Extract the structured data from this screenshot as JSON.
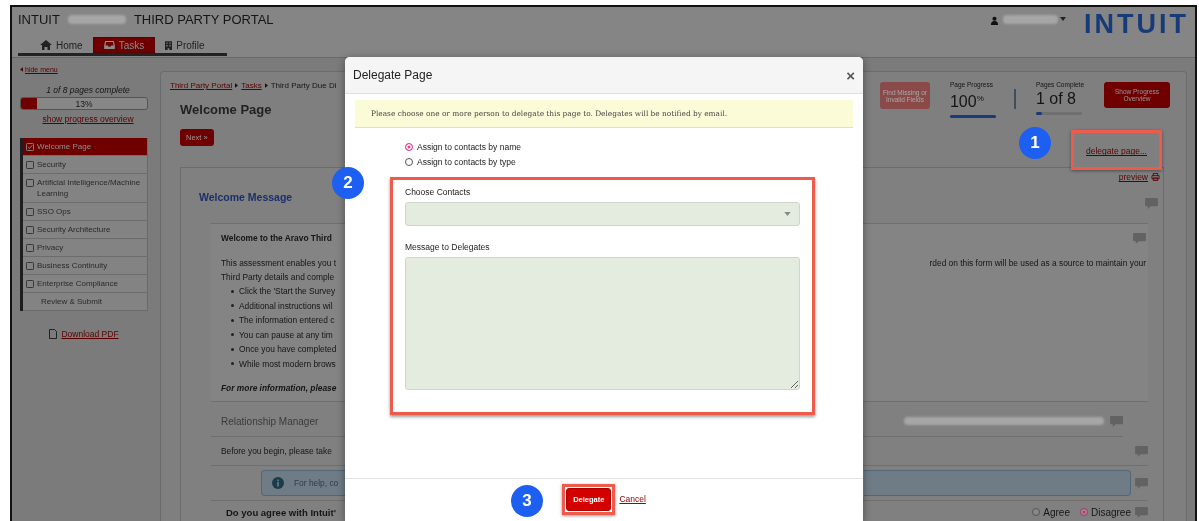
{
  "header": {
    "brand": "INTUIT",
    "title": "THIRD PARTY PORTAL",
    "logo": "INTUIT"
  },
  "nav_tabs": [
    {
      "label": "Home",
      "kind": "home",
      "selected": false
    },
    {
      "label": "Tasks",
      "kind": "tasks",
      "selected": true
    },
    {
      "label": "Profile",
      "kind": "profile",
      "selected": false
    }
  ],
  "sidebar": {
    "hide_menu": "hide menu",
    "progress_text": "1 of 8 pages complete",
    "progress": {
      "level": 0.13,
      "reading": "13%"
    },
    "overview_link": "show progress overview",
    "items": [
      {
        "label": "Welcome Page",
        "kind": "page",
        "checked": true,
        "selected": true
      },
      {
        "label": "Security",
        "kind": "page",
        "checked": false,
        "selected": false
      },
      {
        "label": "Artificial Intelligence/Machine Learning",
        "kind": "page",
        "checked": false,
        "selected": false
      },
      {
        "label": "SSO Ops",
        "kind": "page",
        "checked": false,
        "selected": false
      },
      {
        "label": "Security Architecture",
        "kind": "page",
        "checked": false,
        "selected": false
      },
      {
        "label": "Privacy",
        "kind": "page",
        "checked": false,
        "selected": false
      },
      {
        "label": "Business Continuity",
        "kind": "page",
        "checked": false,
        "selected": false
      },
      {
        "label": "Enterprise Compliance",
        "kind": "page",
        "checked": false,
        "selected": false
      },
      {
        "label": "Review & Submit",
        "kind": "submit",
        "selected": false
      }
    ],
    "download": "Download PDF"
  },
  "breadcrumb": [
    {
      "label": "Third Party Portal",
      "kind": "link"
    },
    {
      "label": "Tasks",
      "kind": "link"
    },
    {
      "label": "Third Party Due Di",
      "kind": "text"
    }
  ],
  "page_title": "Welcome Page",
  "next_button": "Next »",
  "progress_panel": {
    "find_button": "Find Missing or Invalid Fields",
    "meters": [
      {
        "label": "Page Progress",
        "value": "100",
        "unit": "%",
        "level": 1
      },
      {
        "label": "Pages Complete",
        "value": "1 of 8",
        "level": 0.13
      }
    ],
    "overview_button": "Show Progress Overview"
  },
  "delegate_link": "delegate page...",
  "preview_link": "preview",
  "welcome": {
    "title": "Welcome Message",
    "heading": "Welcome to the Aravo Third",
    "lines": [
      "This assessment enables you t",
      "Third Party details and comple"
    ],
    "line_tail": "rded on this form will be used as a source to maintain your",
    "bullets": [
      "Click the 'Start the Survey",
      "Additional instructions wil",
      "The information entered c",
      "You can pause at any tim",
      "Once you have completed",
      "While most modern brows"
    ],
    "more_info": "For more information, please",
    "manager_label": "Relationship Manager",
    "before": "Before you begin, please take",
    "help": "For help, co",
    "question": "Do you agree with Intuit'",
    "answers": [
      {
        "label": "Agree",
        "selected": false
      },
      {
        "label": "Disagree",
        "selected": true
      }
    ]
  },
  "modal": {
    "title": "Delegate Page",
    "close": "×",
    "notice": "Please choose one or more person to delegate this page to. Delegates will be notified by email.",
    "options": [
      {
        "label": "Assign to contacts by name",
        "selected": true
      },
      {
        "label": "Assign to contacts by type",
        "selected": false
      }
    ],
    "contacts_label": "Choose Contacts",
    "message_label": "Message to Delegates",
    "delegate_button": "Delegate",
    "cancel_link": "Cancel"
  },
  "callouts": [
    "1",
    "2",
    "3"
  ]
}
